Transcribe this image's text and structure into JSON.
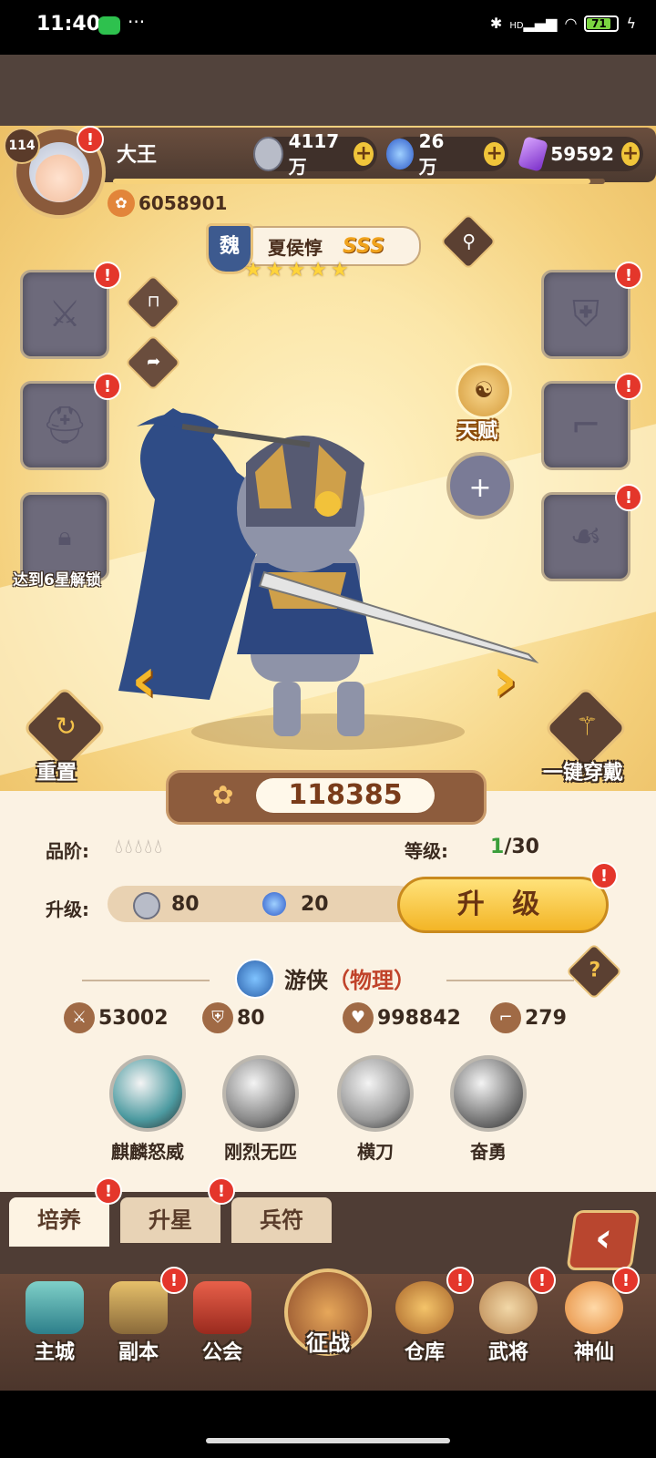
{
  "status_bar": {
    "time": "11:40",
    "more": "···",
    "network": "HD",
    "battery": "71"
  },
  "player": {
    "level": "114",
    "name": "大王",
    "power": "6058901"
  },
  "resources": [
    {
      "icon": "coin-icon",
      "value": "4117万",
      "color": "#b8bcc8"
    },
    {
      "icon": "blue-orb-icon",
      "value": "26万",
      "color": "#3f7fe0"
    },
    {
      "icon": "purple-crystal-icon",
      "value": "59592",
      "color": "#9a4bd8"
    }
  ],
  "exp_progress": 0.97,
  "hero": {
    "faction": "魏",
    "name": "夏侯惇",
    "grade": "SSS",
    "stars": 5
  },
  "locked_slot_text": "达到6星解锁",
  "talent_label": "天赋",
  "actions": {
    "reset": "重置",
    "equip_all": "一键穿戴"
  },
  "combat_power": "118385",
  "quality_label": "品阶:",
  "level_label": "等级:",
  "level_current": "1",
  "level_max": "/30",
  "upgrade_label": "升级:",
  "upgrade_cost": [
    {
      "icon": "coin-icon",
      "value": "80"
    },
    {
      "icon": "blue-orb-icon",
      "value": "20"
    }
  ],
  "upgrade_button": "升 级",
  "hero_class": {
    "name": "游侠",
    "type": "（物理）"
  },
  "stats": [
    {
      "icon": "sword-icon",
      "value": "53002"
    },
    {
      "icon": "shield-icon",
      "value": "80"
    },
    {
      "icon": "heart-icon",
      "value": "998842"
    },
    {
      "icon": "boot-icon",
      "value": "279"
    }
  ],
  "skills": [
    {
      "name": "麒麟怒威",
      "color": "#4c9aa0"
    },
    {
      "name": "刚烈无匹",
      "color": "#8a8a8a"
    },
    {
      "name": "横刀",
      "color": "#9a9a9a"
    },
    {
      "name": "奋勇",
      "color": "#7a7a7a"
    }
  ],
  "tabs": [
    {
      "label": "培养"
    },
    {
      "label": "升星"
    },
    {
      "label": "兵符"
    }
  ],
  "back_icon": "‹",
  "nav": [
    {
      "label": "主城",
      "icon": "city-icon"
    },
    {
      "label": "副本",
      "icon": "swords-icon"
    },
    {
      "label": "公会",
      "icon": "flag-icon"
    },
    {
      "label": "征战",
      "icon": "battle-icon"
    },
    {
      "label": "仓库",
      "icon": "bag-icon"
    },
    {
      "label": "武将",
      "icon": "hero-cat-icon"
    },
    {
      "label": "神仙",
      "icon": "god-cat-icon"
    }
  ]
}
